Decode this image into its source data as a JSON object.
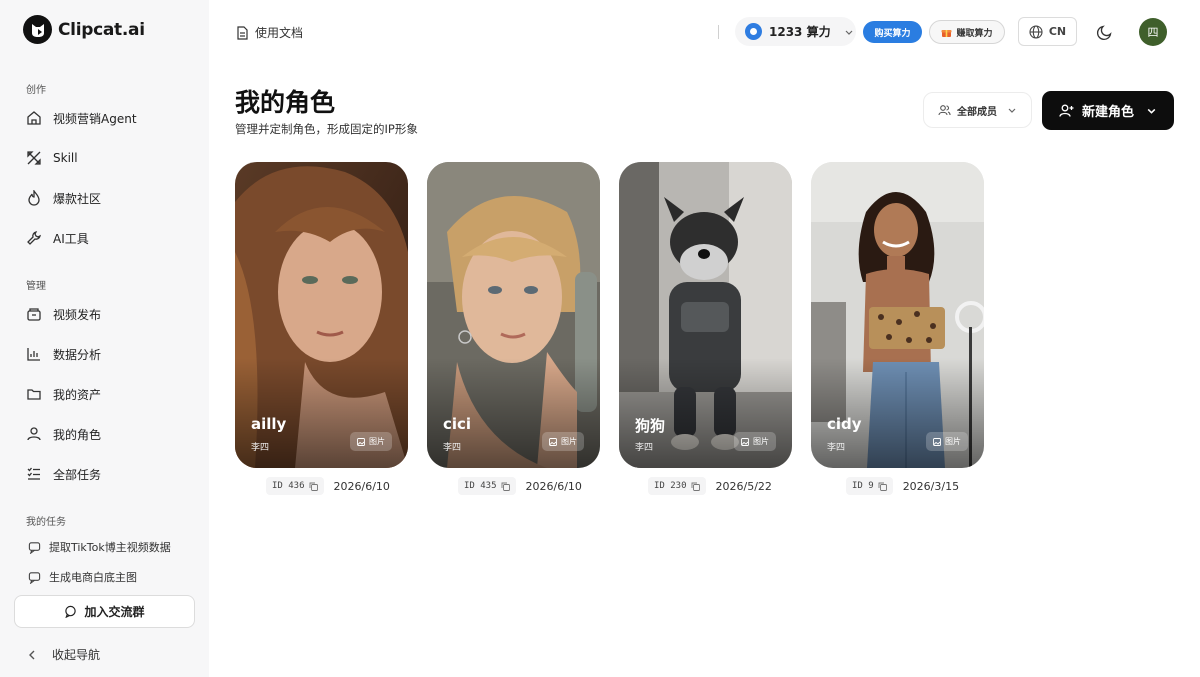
{
  "app": {
    "brand": "Clipcat.ai",
    "logo_icon": "cat-face-icon"
  },
  "sidebar": {
    "section_create": "创作",
    "create_items": [
      {
        "label": "视频营销Agent",
        "icon": "home-icon"
      },
      {
        "label": "Skill",
        "icon": "skill-icon"
      },
      {
        "label": "爆款社区",
        "icon": "flame-icon"
      },
      {
        "label": "AI工具",
        "icon": "wrench-icon"
      }
    ],
    "section_manage": "管理",
    "manage_items": [
      {
        "label": "视频发布",
        "icon": "publish-icon"
      },
      {
        "label": "数据分析",
        "icon": "bar-chart-icon"
      },
      {
        "label": "我的资产",
        "icon": "folder-icon"
      },
      {
        "label": "我的角色",
        "icon": "user-icon"
      },
      {
        "label": "全部任务",
        "icon": "task-list-icon"
      }
    ],
    "section_tasks": "我的任务",
    "tasks": [
      {
        "label": "提取TikTok博主视频数据",
        "icon": "chat-bubble-icon"
      },
      {
        "label": "生成电商白底主图",
        "icon": "chat-bubble-icon"
      }
    ],
    "join_label": "加入交流群",
    "collapse_label": "收起导航"
  },
  "topbar": {
    "doc_label": "使用文档",
    "credits": "1233 算力",
    "buy_label": "购买算力",
    "earn_label": "赚取算力",
    "lang": "CN",
    "avatar_text": "四",
    "accent": "#2a7de1"
  },
  "main": {
    "title": "我的角色",
    "subtitle": "管理并定制角色，形成固定的IP形象",
    "filter_label": "全部成员",
    "new_label": "新建角色"
  },
  "characters": [
    {
      "name": "ailly",
      "owner": "李四",
      "tag": "图片",
      "id": "ID 436",
      "date": "2026/6/10"
    },
    {
      "name": "cici",
      "owner": "李四",
      "tag": "图片",
      "id": "ID 435",
      "date": "2026/6/10"
    },
    {
      "name": "狗狗",
      "owner": "李四",
      "tag": "图片",
      "id": "ID 230",
      "date": "2026/5/22"
    },
    {
      "name": "cidy",
      "owner": "李四",
      "tag": "图片",
      "id": "ID 9",
      "date": "2026/3/15"
    }
  ]
}
